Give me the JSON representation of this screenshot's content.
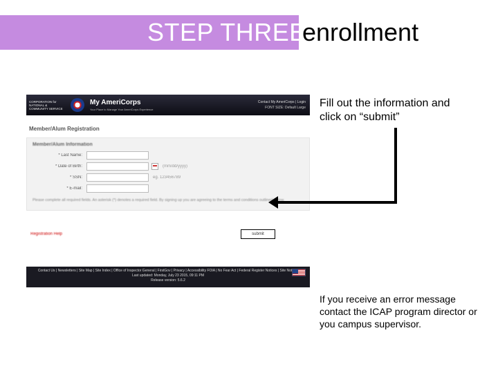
{
  "title": {
    "step": "STEP THREE",
    "word": "enrollment"
  },
  "anno": {
    "line1": "Fill out the information and click on “submit”",
    "line2": "If you receive an error message contact the ICAP program director or you campus supervisor."
  },
  "header": {
    "ncs": "CORPORATION for\nNATIONAL &\nCOMMUNITY\nSERVICE",
    "brand": "My AmeriCorps",
    "brand_sub": "Your Place to Manage Your AmeriCorps Experience",
    "contact": "Contact My AmeriCorps | Login",
    "font_row": "FONT SIZE:  Default  Large"
  },
  "body": {
    "page_title": "Member/Alum Registration",
    "block_title": "Member/Alum Information",
    "fields": {
      "lastname": {
        "label": "* Last Name:",
        "value": ""
      },
      "dob": {
        "label": "* Date of Birth:",
        "value": "",
        "hint": "(mm/dd/yyyy)"
      },
      "ssn": {
        "label": "* SSN:",
        "value": "",
        "hint": "eg. 123456789"
      },
      "email": {
        "label": "* E-mail:",
        "value": ""
      }
    },
    "note": "Please complete all required fields. An asterisk (*) denotes a required field.\nBy signing up you are agreeing to the terms and conditions outlined below.",
    "reg_help": "Registration Help",
    "submit": "submit"
  },
  "footer": {
    "links": "Contact Us | Newsletters | Site Map | Site Index | Office of Inspector General | FirstGov | Privacy | Accessibility\nFOIA | No Fear Act | Federal Register Notices | Site Notices",
    "updated": "Last updated: Monday, July 23 2015, 09:11 PM",
    "version": "Release version: 5.6.2"
  }
}
